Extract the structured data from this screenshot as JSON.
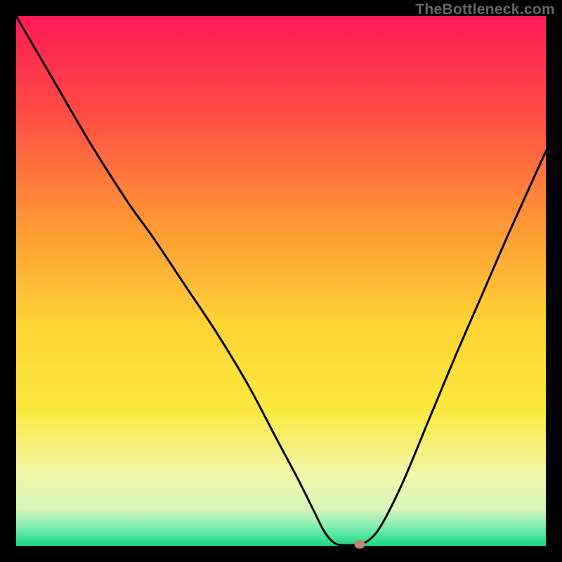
{
  "watermark": {
    "text": "TheBottleneck.com"
  },
  "chart_data": {
    "type": "line",
    "x_range": [
      0,
      1
    ],
    "y_range": [
      0,
      1
    ],
    "curve_points_xy": [
      [
        0.0,
        1.0
      ],
      [
        0.07,
        0.88
      ],
      [
        0.14,
        0.76
      ],
      [
        0.21,
        0.65
      ],
      [
        0.26,
        0.58
      ],
      [
        0.32,
        0.49
      ],
      [
        0.38,
        0.4
      ],
      [
        0.44,
        0.3
      ],
      [
        0.49,
        0.205
      ],
      [
        0.53,
        0.13
      ],
      [
        0.56,
        0.07
      ],
      [
        0.58,
        0.03
      ],
      [
        0.595,
        0.01
      ],
      [
        0.61,
        0.002
      ],
      [
        0.64,
        0.002
      ],
      [
        0.665,
        0.01
      ],
      [
        0.69,
        0.04
      ],
      [
        0.73,
        0.12
      ],
      [
        0.78,
        0.24
      ],
      [
        0.83,
        0.36
      ],
      [
        0.88,
        0.475
      ],
      [
        0.93,
        0.59
      ],
      [
        1.0,
        0.745
      ]
    ],
    "marker_xy": [
      0.648,
      0.002
    ],
    "gradient_stops": [
      {
        "offset": 0.0,
        "color": "#ff1a55"
      },
      {
        "offset": 0.18,
        "color": "#ff4b45"
      },
      {
        "offset": 0.4,
        "color": "#ff9a35"
      },
      {
        "offset": 0.58,
        "color": "#ffd335"
      },
      {
        "offset": 0.74,
        "color": "#fbe83e"
      },
      {
        "offset": 0.86,
        "color": "#f3f7a4"
      },
      {
        "offset": 0.93,
        "color": "#d9f6bd"
      },
      {
        "offset": 0.965,
        "color": "#7bedb2"
      },
      {
        "offset": 1.0,
        "color": "#18d981"
      }
    ],
    "title": "",
    "xlabel": "",
    "ylabel": "",
    "legend": []
  }
}
